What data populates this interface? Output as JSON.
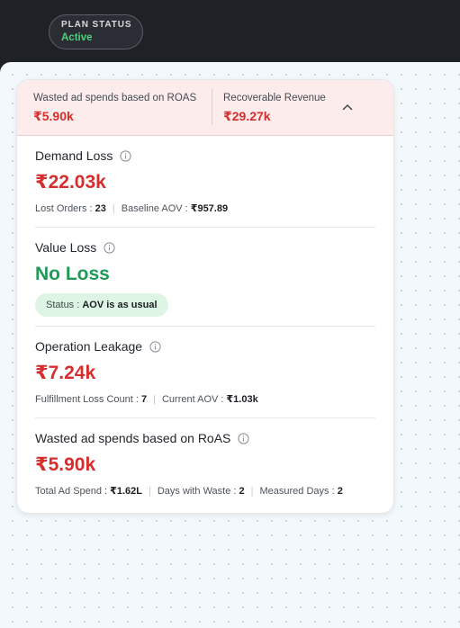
{
  "plan": {
    "label": "PLAN STATUS",
    "value": "Active"
  },
  "header": {
    "left_label": "Wasted ad spends based on ROAS",
    "left_value": "₹5.90k",
    "right_label": "Recoverable Revenue",
    "right_value": "₹29.27k",
    "toggle_icon": "chevron-up-icon"
  },
  "sections": {
    "demand": {
      "title": "Demand Loss",
      "value": "₹22.03k",
      "lost_orders_label": "Lost Orders : ",
      "lost_orders": "23",
      "baseline_aov_label": "Baseline AOV : ",
      "baseline_aov": "₹957.89"
    },
    "value_loss": {
      "title": "Value Loss",
      "value": "No Loss",
      "status_label": "Status : ",
      "status": "AOV is as usual"
    },
    "operation": {
      "title": "Operation Leakage",
      "value": "₹7.24k",
      "fulfillment_label": "Fulfillment Loss Count : ",
      "fulfillment": "7",
      "current_aov_label": "Current AOV : ",
      "current_aov": "₹1.03k"
    },
    "wasted": {
      "title": "Wasted ad spends based on RoAS",
      "value": "₹5.90k",
      "total_spend_label": "Total Ad Spend : ",
      "total_spend": "₹1.62L",
      "days_waste_label": "Days with Waste : ",
      "days_waste": "2",
      "measured_label": "Measured Days : ",
      "measured": "2"
    }
  },
  "colors": {
    "loss": "#d62d2d",
    "ok": "#1f9a58",
    "active": "#4cd07d"
  }
}
